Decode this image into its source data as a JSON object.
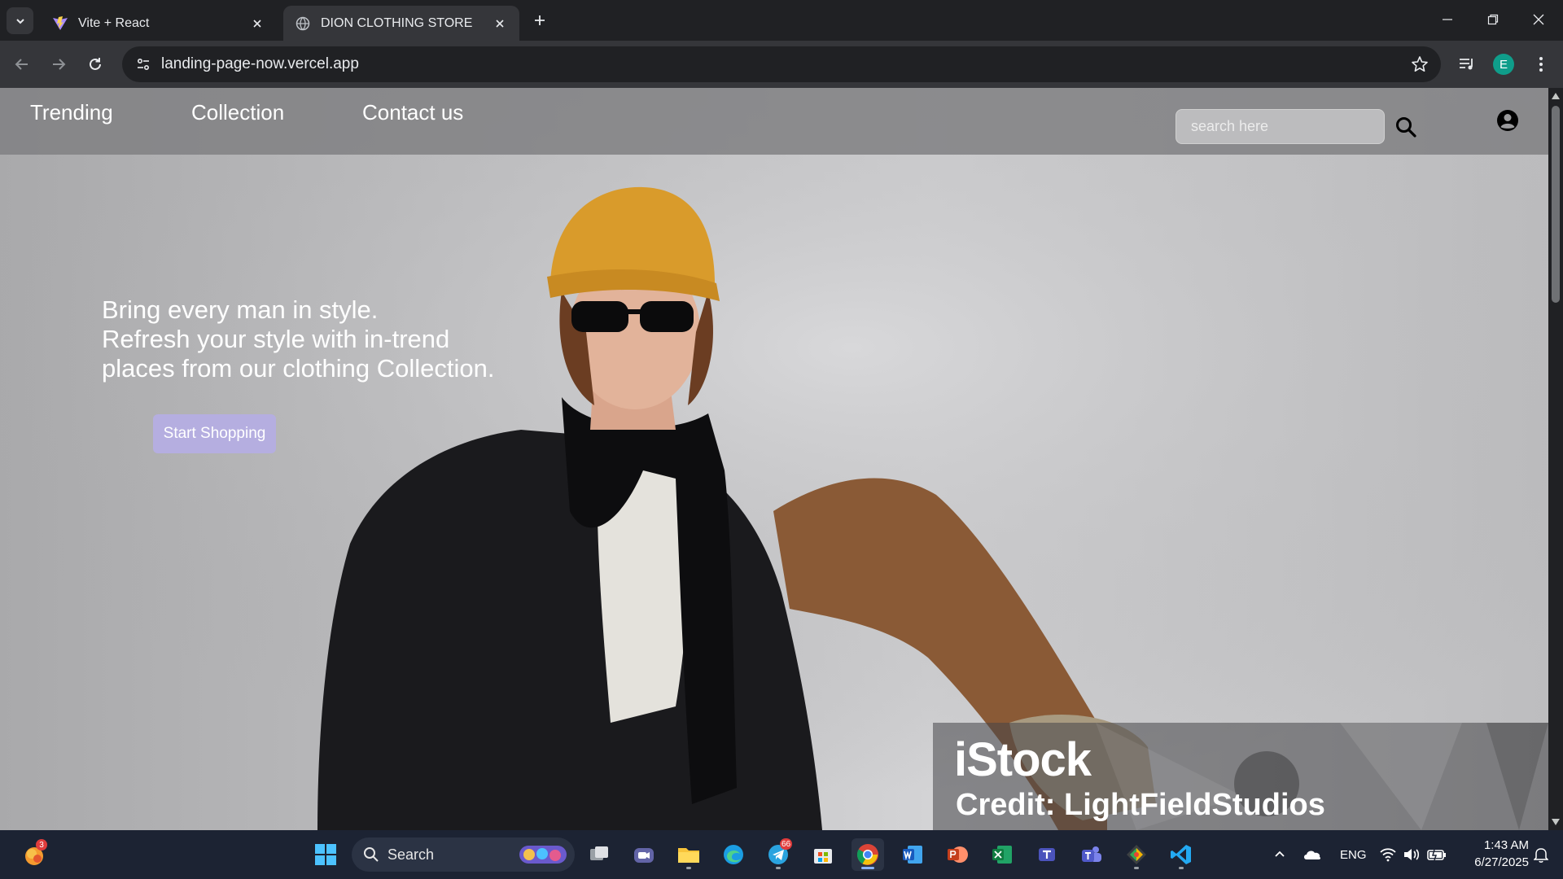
{
  "browser": {
    "tabs": [
      {
        "title": "Vite + React",
        "active": false,
        "favicon": "vite-icon"
      },
      {
        "title": "DION CLOTHING STORE",
        "active": true,
        "favicon": "globe-icon"
      }
    ],
    "url": "landing-page-now.vercel.app",
    "profile_initial": "E"
  },
  "site": {
    "nav": {
      "links": [
        "Trending",
        "Collection",
        "Contact us"
      ]
    },
    "search": {
      "placeholder": "search here"
    },
    "hero": {
      "lines": [
        "Bring every man in style.",
        "Refresh your style with in-trend",
        "places from our clothing Collection."
      ],
      "cta_label": "Start Shopping"
    },
    "watermark": {
      "brand": "iStock",
      "credit": "Credit: LightFieldStudios"
    }
  },
  "taskbar": {
    "search_label": "Search",
    "language": "ENG",
    "time": "1:43 AM",
    "date": "6/27/2025",
    "badges": {
      "left_app": "3",
      "telegram": "66"
    }
  },
  "colors": {
    "cta": "#b5aee0",
    "navbar": "#808082",
    "taskbar": "#1c2333",
    "browser_frame": "#202124"
  }
}
